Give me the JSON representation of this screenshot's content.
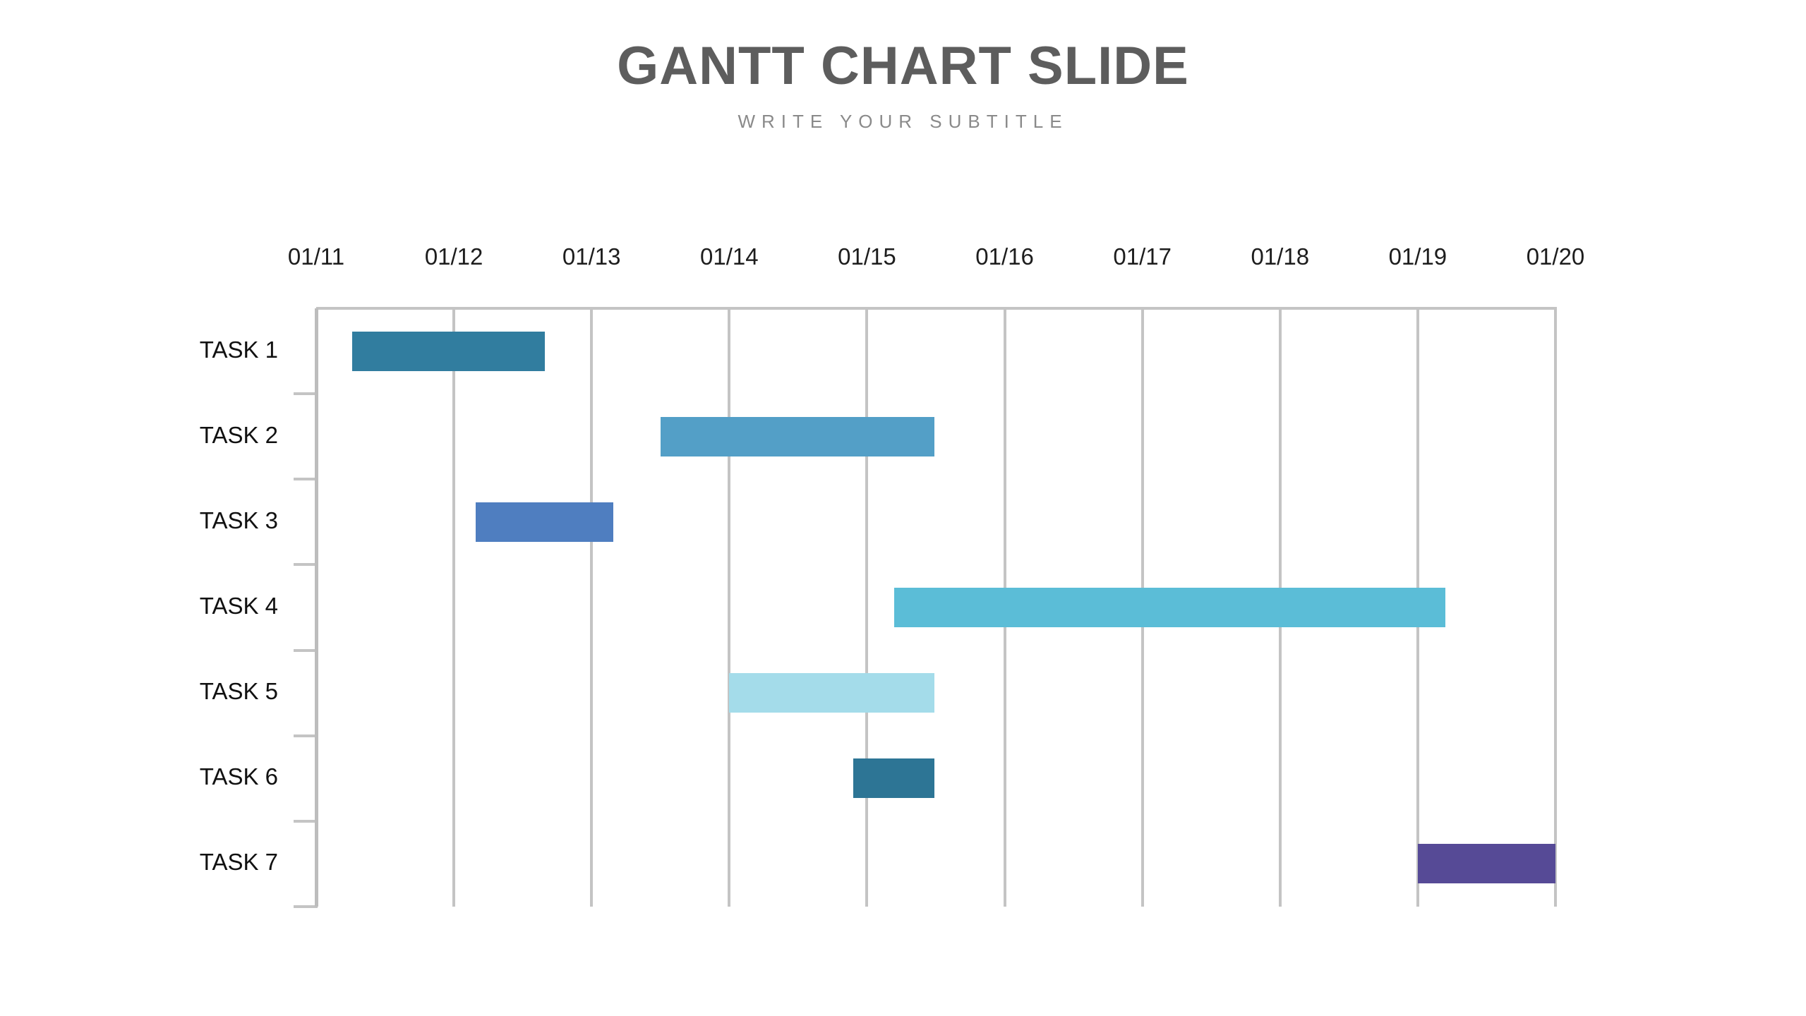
{
  "header": {
    "title": "GANTT CHART SLIDE",
    "subtitle": "WRITE YOUR SUBTITLE"
  },
  "chart_data": {
    "type": "bar",
    "chart_subtype": "gantt",
    "title": "GANTT CHART SLIDE",
    "subtitle": "WRITE YOUR SUBTITLE",
    "xlabel": "",
    "ylabel": "",
    "grid": true,
    "legend": "none",
    "orientation": "horizontal",
    "x_axis_position": "top",
    "x_tick_labels": [
      "01/11",
      "01/12",
      "01/13",
      "01/14",
      "01/15",
      "01/16",
      "01/17",
      "01/18",
      "01/19",
      "01/20"
    ],
    "x_tick_values": [
      0,
      1,
      2,
      3,
      4,
      5,
      6,
      7,
      8,
      9
    ],
    "xlim": [
      0,
      9
    ],
    "categories": [
      "TASK 1",
      "TASK 2",
      "TASK 3",
      "TASK 4",
      "TASK 5",
      "TASK 6",
      "TASK 7"
    ],
    "bars": [
      {
        "task": "TASK 1",
        "start_label": "01/11",
        "end_label": "01/13",
        "start": 0.26,
        "end": 1.66,
        "duration": 1.4,
        "color": "#317d9f"
      },
      {
        "task": "TASK 2",
        "start_label": "01/13",
        "end_label": "01/16",
        "start": 2.5,
        "end": 4.49,
        "duration": 1.99,
        "color": "#539fc7"
      },
      {
        "task": "TASK 3",
        "start_label": "01/12",
        "end_label": "01/14",
        "start": 1.16,
        "end": 2.16,
        "duration": 1.0,
        "color": "#4f7ec0"
      },
      {
        "task": "TASK 4",
        "start_label": "01/16",
        "end_label": "01/19",
        "start": 4.2,
        "end": 8.2,
        "duration": 4.0,
        "color": "#5bbdd7"
      },
      {
        "task": "TASK 5",
        "start_label": "01/14",
        "end_label": "01/16",
        "start": 3.0,
        "end": 4.49,
        "duration": 1.49,
        "color": "#a4dcea"
      },
      {
        "task": "TASK 6",
        "start_label": "01/15",
        "end_label": "01/16",
        "start": 3.9,
        "end": 4.49,
        "duration": 0.59,
        "color": "#2d7595"
      },
      {
        "task": "TASK 7",
        "start_label": "01/19",
        "end_label": "01/20",
        "start": 8.0,
        "end": 9.0,
        "duration": 1.0,
        "color": "#564a96"
      }
    ]
  },
  "colors": {
    "title": "#5d5d5d",
    "subtitle": "#8a8a8a",
    "grid": "#c4c4c4",
    "axis_text": "#111111",
    "background": "#ffffff"
  }
}
